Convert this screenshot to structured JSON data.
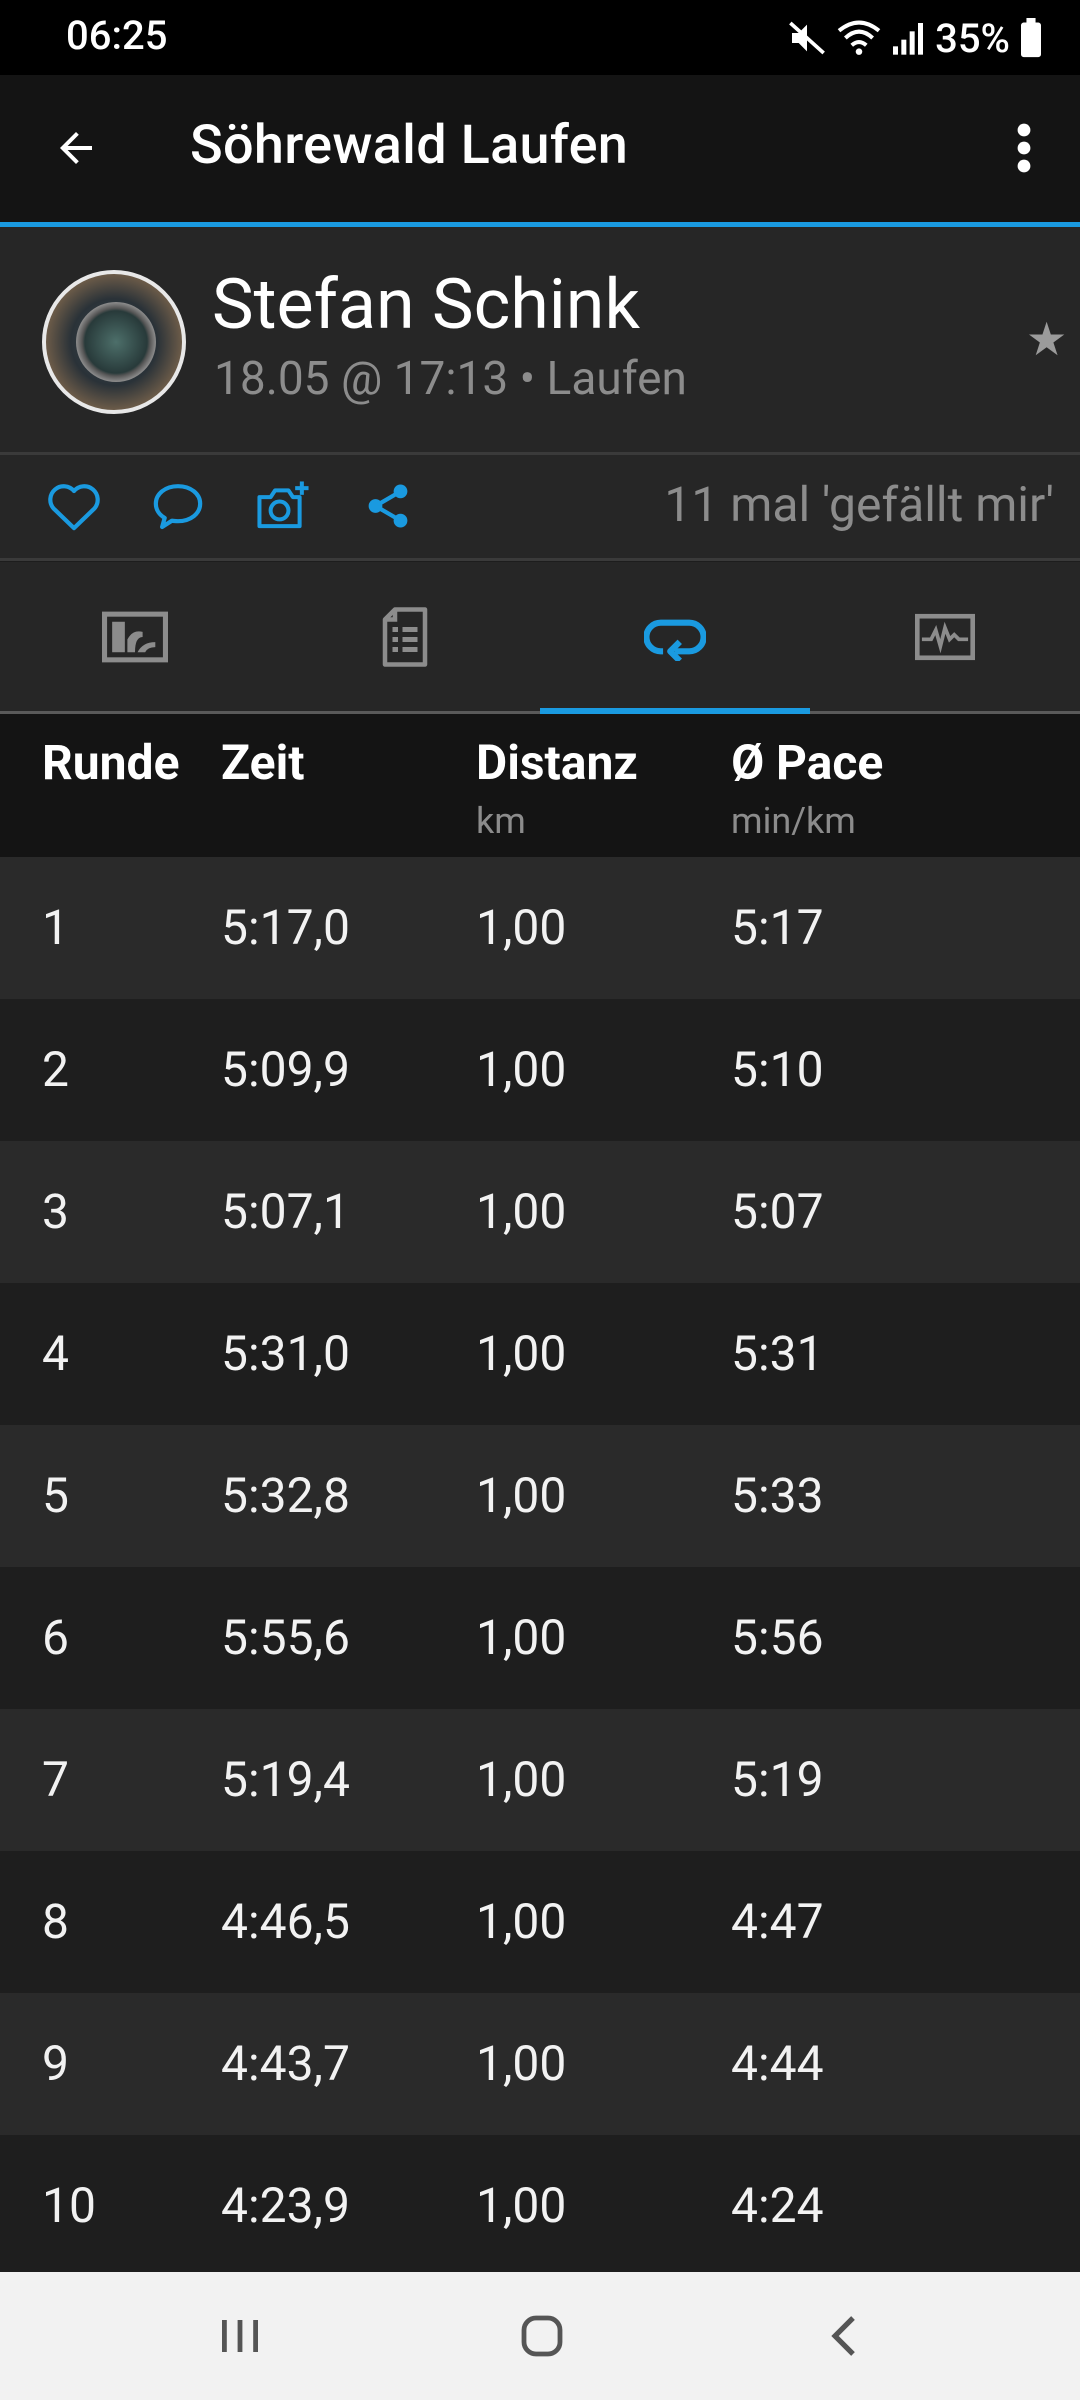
{
  "status_bar": {
    "time": "06:25",
    "battery": "35%"
  },
  "app_bar": {
    "title": "Söhrewald Laufen"
  },
  "activity": {
    "user_name": "Stefan Schink",
    "subtitle": "18.05 @ 17:13 • Laufen",
    "likes_text": "11 mal 'gefällt mir'"
  },
  "colors": {
    "accent": "#1a9ae0",
    "icon_grey": "#8c8c8c"
  },
  "tabs": [
    {
      "icon": "stats-icon",
      "selected": false
    },
    {
      "icon": "document-icon",
      "selected": false
    },
    {
      "icon": "laps-icon",
      "selected": true
    },
    {
      "icon": "chart-icon",
      "selected": false
    }
  ],
  "table": {
    "headers": {
      "lap": "Runde",
      "time": "Zeit",
      "distance": "Distanz",
      "distance_unit": "km",
      "pace": "Ø Pace",
      "pace_unit": "min/km"
    },
    "rows": [
      {
        "lap": "1",
        "time": "5:17,0",
        "distance": "1,00",
        "pace": "5:17"
      },
      {
        "lap": "2",
        "time": "5:09,9",
        "distance": "1,00",
        "pace": "5:10"
      },
      {
        "lap": "3",
        "time": "5:07,1",
        "distance": "1,00",
        "pace": "5:07"
      },
      {
        "lap": "4",
        "time": "5:31,0",
        "distance": "1,00",
        "pace": "5:31"
      },
      {
        "lap": "5",
        "time": "5:32,8",
        "distance": "1,00",
        "pace": "5:33"
      },
      {
        "lap": "6",
        "time": "5:55,6",
        "distance": "1,00",
        "pace": "5:56"
      },
      {
        "lap": "7",
        "time": "5:19,4",
        "distance": "1,00",
        "pace": "5:19"
      },
      {
        "lap": "8",
        "time": "4:46,5",
        "distance": "1,00",
        "pace": "4:47"
      },
      {
        "lap": "9",
        "time": "4:43,7",
        "distance": "1,00",
        "pace": "4:44"
      },
      {
        "lap": "10",
        "time": "4:23,9",
        "distance": "1,00",
        "pace": "4:24"
      }
    ]
  }
}
